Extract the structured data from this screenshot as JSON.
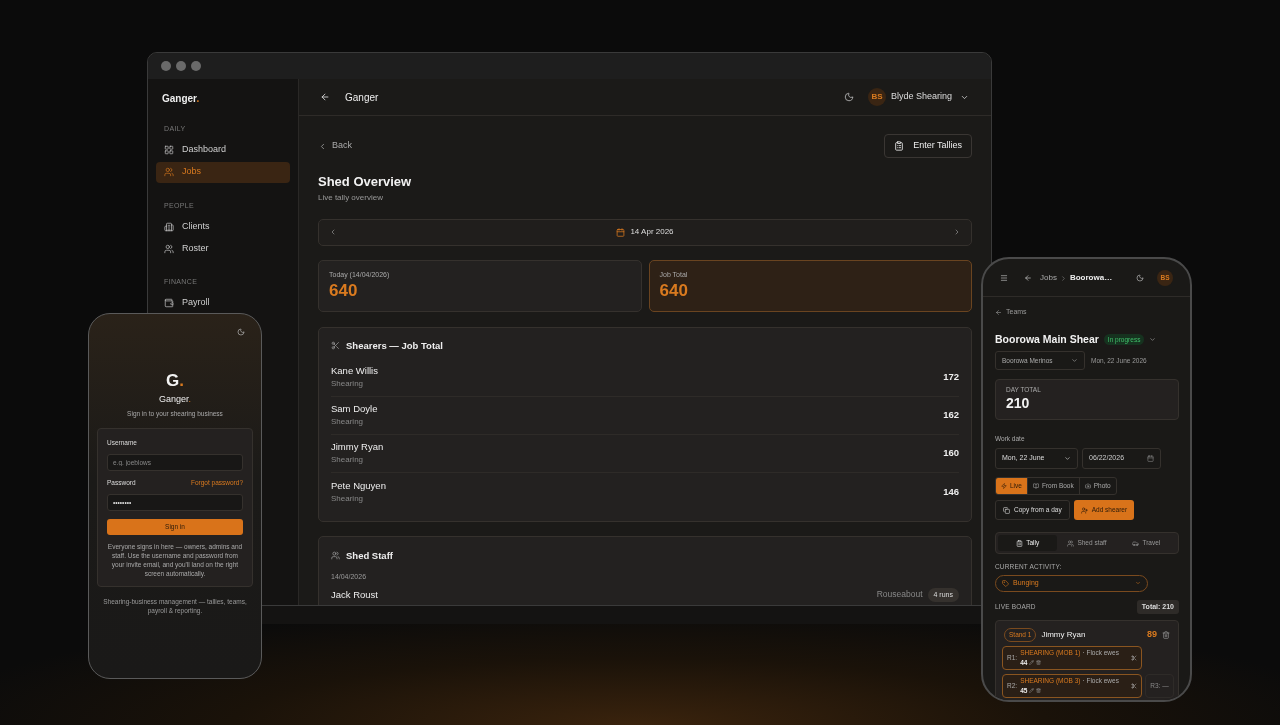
{
  "laptop": {
    "sidebar": {
      "logo": {
        "name": "Ganger",
        "mark": "."
      },
      "sections": [
        {
          "heading": "DAILY",
          "items": [
            {
              "label": "Dashboard",
              "selected": false
            },
            {
              "label": "Jobs",
              "selected": true
            }
          ]
        },
        {
          "heading": "PEOPLE",
          "items": [
            {
              "label": "Clients",
              "selected": false
            },
            {
              "label": "Roster",
              "selected": false
            }
          ]
        },
        {
          "heading": "FINANCE",
          "items": [
            {
              "label": "Payroll",
              "selected": false
            }
          ]
        }
      ]
    },
    "header": {
      "title": "Ganger",
      "user": {
        "initials": "BS",
        "name": "Blyde Shearing"
      }
    },
    "page": {
      "back": "Back",
      "action": "Enter Tallies",
      "title": "Shed Overview",
      "subtitle": "Live tally overview",
      "date": "14 Apr 2026",
      "stats": [
        {
          "label": "Today (14/04/2026)",
          "value": "640",
          "highlighted": false
        },
        {
          "label": "Job Total",
          "value": "640",
          "highlighted": true
        }
      ],
      "shearers": {
        "title": "Shearers — Job Total",
        "rows": [
          {
            "name": "Kane Willis",
            "role": "Shearing",
            "count": "172"
          },
          {
            "name": "Sam Doyle",
            "role": "Shearing",
            "count": "162"
          },
          {
            "name": "Jimmy Ryan",
            "role": "Shearing",
            "count": "160"
          },
          {
            "name": "Pete Nguyen",
            "role": "Shearing",
            "count": "146"
          }
        ]
      },
      "staff": {
        "title": "Shed Staff",
        "date": "14/04/2026",
        "rows": [
          {
            "name": "Jack Roust",
            "role": "Rouseabout",
            "badge": "4 runs"
          }
        ]
      }
    }
  },
  "login_phone": {
    "logo_letter": "G",
    "logo_mark": ".",
    "name": "Ganger",
    "name_mark": ".",
    "subtitle": "Sign in to your shearing business",
    "username": {
      "label": "Username",
      "placeholder": "e.g. joeblows"
    },
    "password": {
      "label": "Password",
      "value": "••••••••",
      "link": "Forgot password?"
    },
    "submit": "Sign in",
    "note": "Everyone signs in here — owners, admins and staff. Use the username and password from your invite email, and you'll land on the right screen automatically.",
    "footer": "Shearing-business management — tallies, teams, payroll & reporting."
  },
  "mobile": {
    "breadcrumb": {
      "parent": "Jobs",
      "current": "Boorowa…"
    },
    "avatar": "BS",
    "back": "Teams",
    "title": "Boorowa Main Shear",
    "status": "In progress",
    "team_select": "Boorowa Merinos",
    "date_text": "Mon, 22 June 2026",
    "day_total": {
      "label": "DAY TOTAL",
      "value": "210"
    },
    "work_date": {
      "label": "Work date",
      "select": "Mon, 22 June",
      "input": "06/22/2026"
    },
    "modes": [
      {
        "label": "Live",
        "selected": true
      },
      {
        "label": "From Book",
        "selected": false
      },
      {
        "label": "Photo",
        "selected": false
      }
    ],
    "actions": [
      {
        "label": "Copy from a day",
        "kind": "secondary"
      },
      {
        "label": "Add shearer",
        "kind": "primary"
      }
    ],
    "tabs": [
      {
        "label": "Tally",
        "selected": true
      },
      {
        "label": "Shed staff",
        "selected": false
      },
      {
        "label": "Travel",
        "selected": false
      }
    ],
    "activity": {
      "label": "CURRENT ACTIVITY:",
      "value": "Bunging"
    },
    "board": {
      "label": "LIVE BOARD",
      "total": "Total: 210",
      "stand": {
        "badge": "Stand 1",
        "name": "Jimmy Ryan",
        "count": "89",
        "run_rows": [
          [
            {
              "kind": "run",
              "label": "R1:",
              "activity": "SHEARING (MOB 1)",
              "detail": "· Flock ewes",
              "count": "44"
            }
          ],
          [
            {
              "kind": "run",
              "label": "R2:",
              "activity": "SHEARING (MOB 3)",
              "detail": "· Flock ewes",
              "count": "45"
            },
            {
              "kind": "empty",
              "label": "R3:",
              "value": "—"
            }
          ]
        ]
      }
    }
  }
}
